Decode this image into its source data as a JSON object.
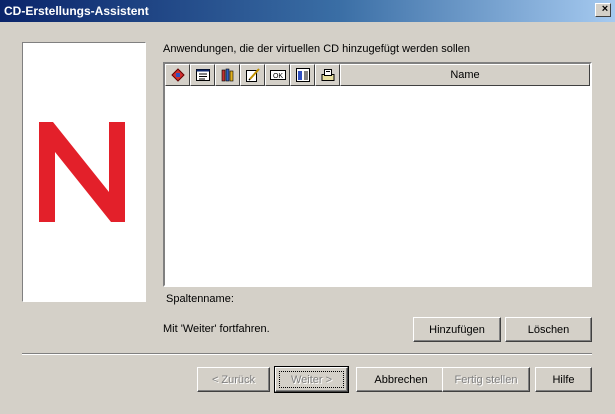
{
  "window": {
    "title": "CD-Erstellungs-Assistent",
    "close_glyph": "×"
  },
  "heading": "Anwendungen, die der virtuellen CD hinzugefügt werden sollen",
  "list": {
    "icon_columns": [
      "application-icon",
      "properties-icon",
      "books-icon",
      "edit-icon",
      "ok-icon",
      "group-icon",
      "export-icon"
    ],
    "name_column": "Name",
    "rows": []
  },
  "spaltenname_label": "Spaltenname:",
  "hint": "Mit 'Weiter' fortfahren.",
  "buttons": {
    "add": "Hinzufügen",
    "delete": "Löschen",
    "back": "< Zurück",
    "next": "Weiter >",
    "cancel": "Abbrechen",
    "finish": "Fertig stellen",
    "help": "Hilfe"
  },
  "colors": {
    "logo_red": "#e3202a",
    "titlebar_start": "#0a246a",
    "titlebar_end": "#a6caf0",
    "face": "#d4d0c8"
  }
}
